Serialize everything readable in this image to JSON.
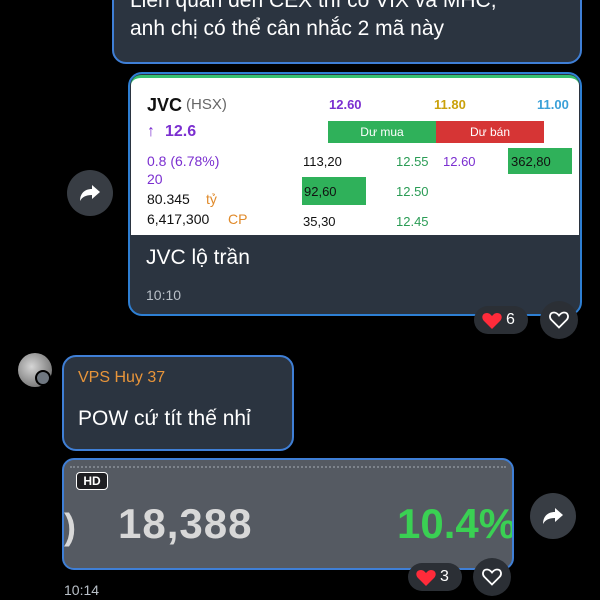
{
  "top_message": {
    "line1": "Liên quan đến CEX thì có VIX và MHC,",
    "line2": "anh chị có thể cân nhắc 2 mã này"
  },
  "quote_message": {
    "card": {
      "symbol": "JVC",
      "exchange": "(HSX)",
      "ceiling": "12.60",
      "reference": "11.80",
      "floor": "11.00",
      "arrow": "↑",
      "price": "12.6",
      "buy_label": "Dư mua",
      "sell_label": "Dư bán",
      "change": "0.8 (6.78%)",
      "extra": "20",
      "value": "80.345",
      "value_unit": "tỷ",
      "volume": "6,417,300",
      "volume_unit": "CP",
      "orderbook": {
        "bid1_vol": "113,20",
        "bid1_price": "12.55",
        "ask1_price": "12.60",
        "ask1_vol": "362,80",
        "bid2_vol": "92,60",
        "bid2_price": "12.50",
        "bid3_vol": "35,30",
        "bid3_price": "12.45"
      }
    },
    "text": "JVC lộ trần",
    "time": "10:10",
    "reaction_count": "6"
  },
  "message2": {
    "author": "VPS Huy 37",
    "text": "POW cứ tít thế nhỉ"
  },
  "image_message": {
    "badge": "HD",
    "lead": ")",
    "number": "18,388",
    "percent": "10.4%",
    "time": "10:14",
    "reaction_count": "3"
  },
  "icons": {
    "forward": "forward-arrow-icon",
    "reaction": "red-heart-icon",
    "like": "heart-outline-icon"
  },
  "colors": {
    "background": "#000000",
    "bubble": "#2b3440",
    "bubble_border": "#3f7fd6",
    "author": "#e8953a",
    "gain": "#3ad053",
    "ceiling_purple": "#7b2fd0"
  }
}
